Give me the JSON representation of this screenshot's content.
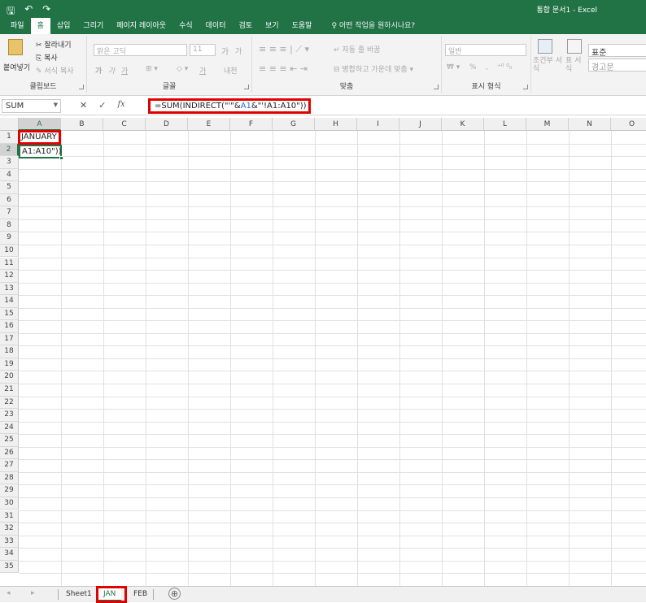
{
  "titlebar": {
    "save_icon": "save-icon",
    "undo_icon": "undo-icon",
    "redo_icon": "redo-icon",
    "document_title": "통합 문서1 - Excel"
  },
  "ribbon_tabs": [
    "파일",
    "홈",
    "삽입",
    "그리기",
    "페이지 레이아웃",
    "수식",
    "데이터",
    "검토",
    "보기",
    "도움말"
  ],
  "active_tab": "홈",
  "tell_me": "어떤 작업을 원하시나요?",
  "ribbon": {
    "clipboard": {
      "paste": "붙여넣기",
      "cut": "잘라내기",
      "copy": "복사",
      "format_painter": "서식 복사",
      "label": "클립보드"
    },
    "font": {
      "name": "맑은 고딕",
      "size": "11",
      "grow": "가",
      "shrink": "가",
      "bold": "가",
      "italic": "가",
      "underline": "가",
      "font_color": "가",
      "phonetic": "내천",
      "label": "글꼴"
    },
    "alignment": {
      "wrap_text": "자동 줄 바꿈",
      "merge_center": "병합하고 가운데 맞춤",
      "label": "맞춤"
    },
    "number": {
      "format": "일반",
      "percent": "%",
      "comma": ",",
      "label": "표시 형식"
    },
    "styles": {
      "conditional": "조건부 서식",
      "table": "표 서식",
      "normal": "표준",
      "warning": "경고문"
    }
  },
  "formula_bar": {
    "name_box": "SUM",
    "cancel": "✕",
    "enter": "✓",
    "fx": "fx",
    "formula_prefix": "=SUM(INDIRECT(\"'\"&",
    "formula_ref": "A1",
    "formula_suffix": "&\"'!A1:A10\"))"
  },
  "columns": [
    "A",
    "B",
    "C",
    "D",
    "E",
    "F",
    "G",
    "H",
    "I",
    "J",
    "K",
    "L",
    "M",
    "N",
    "O"
  ],
  "rows": [
    "1",
    "2",
    "3",
    "4",
    "5",
    "6",
    "7",
    "8",
    "9",
    "10",
    "11",
    "12",
    "13",
    "14",
    "15",
    "16",
    "17",
    "18",
    "19",
    "20",
    "21",
    "22",
    "23",
    "24",
    "25",
    "26",
    "27",
    "28",
    "29",
    "30",
    "31",
    "32",
    "33",
    "34",
    "35"
  ],
  "cells": {
    "A1": "JANUARY",
    "A2": "A1:A10\"))"
  },
  "sheet_tabs": [
    "Sheet1",
    "JAN",
    "FEB"
  ],
  "active_sheet": "JAN",
  "add_sheet": "⊕"
}
